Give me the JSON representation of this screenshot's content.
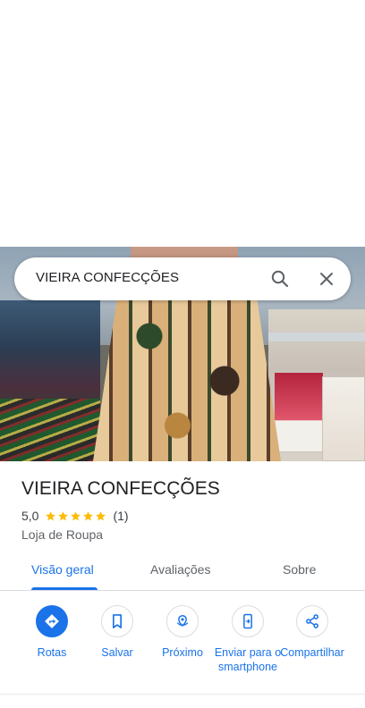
{
  "search": {
    "query": "VIEIRA CONFECÇÕES"
  },
  "place": {
    "name": "VIEIRA CONFECÇÕES",
    "rating": "5,0",
    "stars": 5,
    "review_count": "(1)",
    "category": "Loja de Roupa"
  },
  "tabs": [
    {
      "label": "Visão geral",
      "active": true
    },
    {
      "label": "Avaliações",
      "active": false
    },
    {
      "label": "Sobre",
      "active": false
    }
  ],
  "actions": [
    {
      "label": "Rotas",
      "icon": "directions-icon"
    },
    {
      "label": "Salvar",
      "icon": "bookmark-icon"
    },
    {
      "label": "Próximo",
      "icon": "nearby-icon"
    },
    {
      "label": "Enviar para o smartphone",
      "icon": "send-to-phone-icon"
    },
    {
      "label": "Compartilhar",
      "icon": "share-icon"
    }
  ],
  "colors": {
    "accent": "#1a73e8",
    "star": "#fbbc04",
    "text": "#202124",
    "secondary": "#5f6368"
  }
}
